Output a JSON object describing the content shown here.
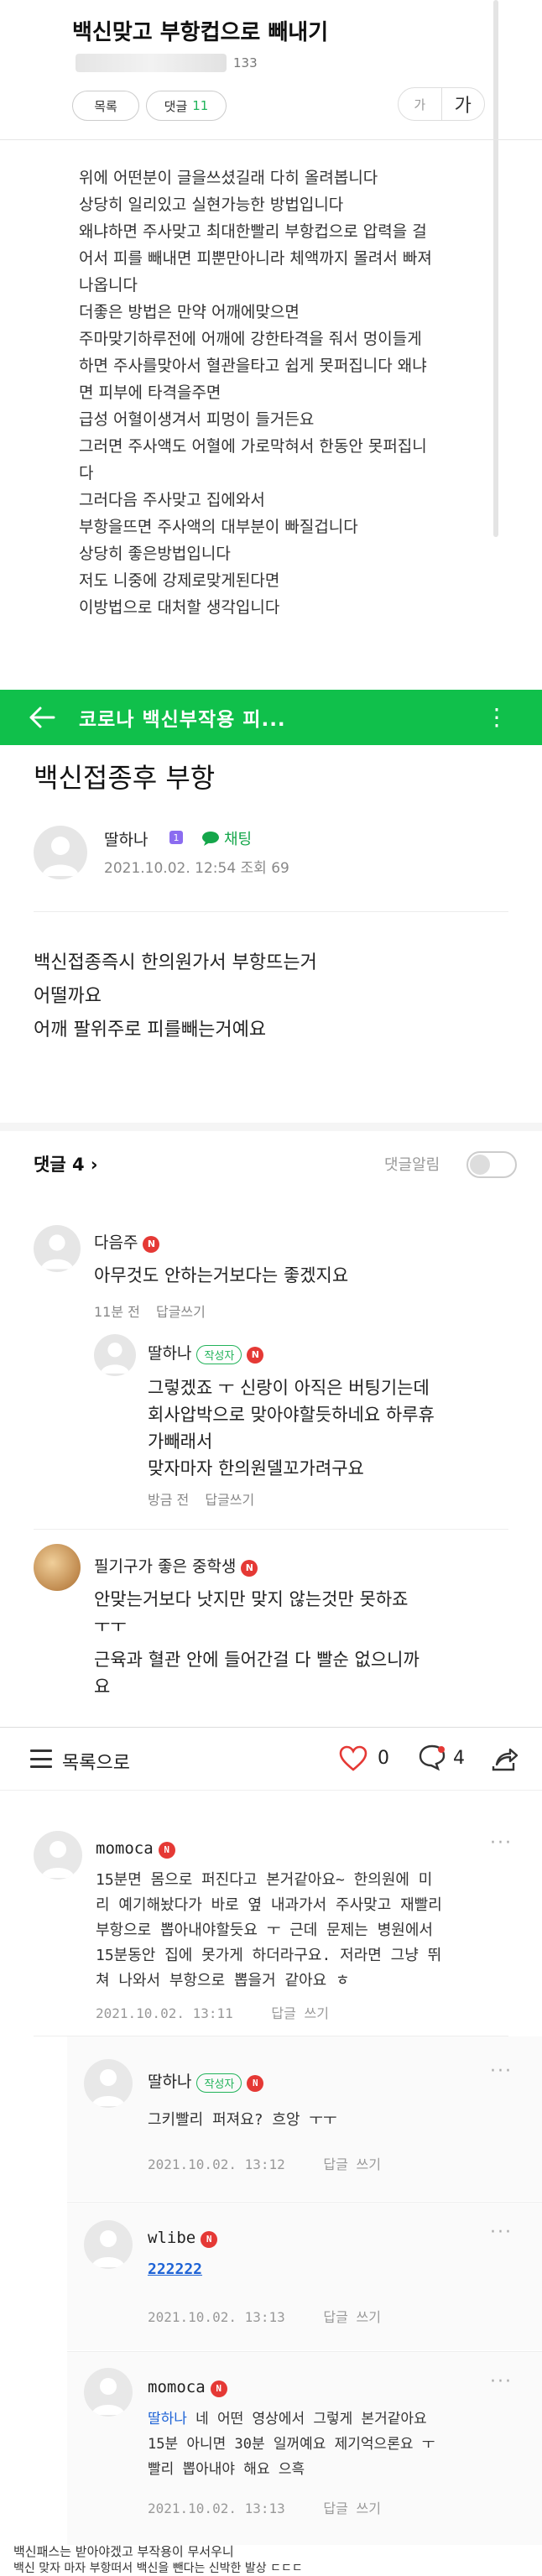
{
  "panel1": {
    "title": "백신맞고 부항컵으로 빼내기",
    "author_suffix": "133",
    "list_button": "목록",
    "comment_button": "댓글",
    "comment_count": "11",
    "font_small": "가",
    "font_large": "가",
    "body_lines": [
      "위에 어떤분이 글을쓰셨길래 다히 올려봅니다",
      "상당히 일리있고 실현가능한 방법입니다",
      "왜냐하면 주사맞고 최대한빨리 부항컵으로 압력을 걸",
      "어서 피를 빼내면 피뿐만아니라 체액까지 몰려서 빠져",
      "나옵니다",
      "더좋은 방법은 만약 어깨에맞으면",
      "주마맞기하루전에 어깨에 강한타격을 줘서 멍이들게",
      "하면 주사를맞아서 혈관을타고 쉽게 못퍼집니다 왜냐",
      "면 피부에 타격을주면",
      "급성 어혈이생겨서 피멍이 들거든요",
      "그러면 주사액도 어혈에 가로막혀서 한동안 못퍼집니",
      "다",
      "그러다음 주사맞고 집에와서",
      "부항을뜨면 주사액의 대부분이 빠질겁니다",
      "상당히 좋은방법입니다",
      "저도 니중에 강제로맞게된다면",
      "이방법으로 대처할 생각입니다"
    ]
  },
  "panel2": {
    "bar_title": "코로나 백신부작용 피...",
    "post_title": "백신접종후 부항",
    "author": "딸하나",
    "level": "1",
    "chat_label": "채팅",
    "date": "2021.10.02. 12:54",
    "views": "조회 69",
    "body_lines": [
      "백신접종즉시 한의원가서 부항뜨는거",
      "어떨까요",
      "어깨 팔위주로 피를빼는거예요"
    ],
    "comments_label": "댓글 4",
    "alert_label": "댓글알림",
    "comments": [
      {
        "name": "다음주",
        "text": "아무것도 안하는거보다는 좋겠지요",
        "time": "11분 전",
        "reply": "답글쓰기"
      },
      {
        "name": "딸하나",
        "writer_badge": "작성자",
        "lines": [
          "그렇겠죠 ㅜ 신랑이 아직은 버팅기는데",
          "회사압박으로 맞아야할듯하네요 하루휴",
          "가빼래서",
          "맞자마자 한의원델꼬가려구요"
        ],
        "time": "방금 전",
        "reply": "답글쓰기"
      },
      {
        "name": "필기구가 좋은 중학생",
        "lines": [
          "안맞는거보다 낫지만 맞지 않는것만 못하죠",
          "ㅜㅜ",
          "근육과 혈관 안에 들어간걸 다 빨순 없으니까",
          "요"
        ]
      }
    ]
  },
  "panel3": {
    "list_label": "목록으로",
    "likes": "0",
    "comments": "4",
    "items": [
      {
        "name": "momoca",
        "lines": [
          "15분면 몸으로 퍼진다고 본거같아요~ 한의원에 미",
          "리 예기해놨다가 바로 옆 내과가서 주사맞고 재빨리",
          "부항으로 뽑아내야할듯요 ㅜ 근데 문제는 병원에서",
          "15분동안 집에 못가게 하더라구요. 저라면 그냥 뛰",
          "쳐 나와서 부항으로 뽑을거 같아요 ㅎ"
        ],
        "date": "2021.10.02. 13:11",
        "reply": "답글 쓰기"
      },
      {
        "name": "딸하나",
        "writer_badge": "작성자",
        "lines": [
          "그키빨리 퍼져요? 흐앙 ㅜㅜ"
        ],
        "date": "2021.10.02. 13:12",
        "reply": "답글 쓰기"
      },
      {
        "name": "wlibe",
        "lines": [
          "222222"
        ],
        "date": "2021.10.02. 13:13",
        "reply": "답글 쓰기"
      },
      {
        "name": "momoca",
        "lines": [
          "딸하나 네 어떤 영상에서 그렇게 본거같아요",
          "15분 아니면 30분 일꺼예요 제기억으론요 ㅜ",
          "빨리 뽑아내야 해요 으흑"
        ],
        "mention": "딸하나",
        "date": "2021.10.02. 13:13",
        "reply": "답글 쓰기"
      }
    ]
  },
  "captions": [
    "백신패스는 받아야겠고 부작용이 무서우니",
    "백신 맞자 마자 부항떠서 백신을 뺀다는 신박한 발상 ㄷㄷㄷ"
  ]
}
